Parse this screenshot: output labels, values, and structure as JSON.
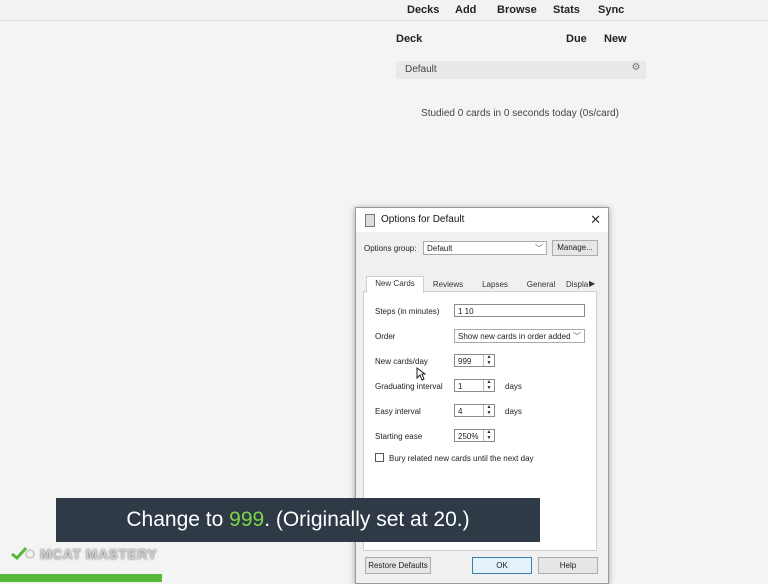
{
  "topnav": {
    "decks": "Decks",
    "add": "Add",
    "browse": "Browse",
    "stats": "Stats",
    "sync": "Sync"
  },
  "decklist": {
    "col_deck": "Deck",
    "col_due": "Due",
    "col_new": "New",
    "rows": [
      {
        "name": "Default"
      }
    ],
    "studied": "Studied 0 cards in 0 seconds today (0s/card)"
  },
  "dialog": {
    "title": "Options for Default",
    "options_group_label": "Options group:",
    "options_group_value": "Default",
    "manage_label": "Manage...",
    "tabs": [
      "New Cards",
      "Reviews",
      "Lapses",
      "General",
      "Display"
    ],
    "fields": {
      "steps_label": "Steps (in minutes)",
      "steps_value": "1 10",
      "order_label": "Order",
      "order_value": "Show new cards in order added",
      "newcards_label": "New cards/day",
      "newcards_value": "999",
      "grad_label": "Graduating interval",
      "grad_value": "1",
      "grad_unit": "days",
      "easy_label": "Easy interval",
      "easy_value": "4",
      "easy_unit": "days",
      "ease_label": "Starting ease",
      "ease_value": "250%"
    },
    "bury_label": "Bury related new cards until the next day",
    "buttons": {
      "restore": "Restore Defaults",
      "ok": "OK",
      "help": "Help"
    }
  },
  "caption": {
    "pre": "Change to ",
    "highlight": "999",
    "post": ". (Originally set at 20.)"
  },
  "brand": {
    "logo_text": "MCAT MASTERY",
    "accent": "#58b83a"
  }
}
